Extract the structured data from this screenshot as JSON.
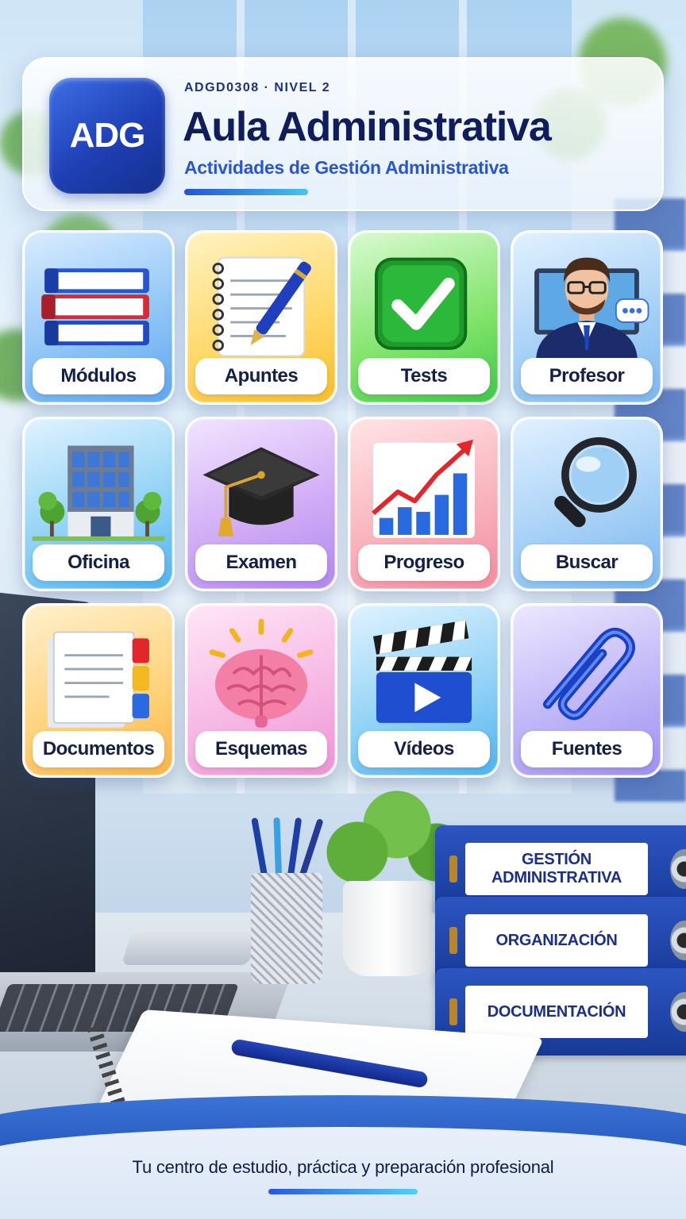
{
  "header": {
    "logo_text": "ADG",
    "overline": "ADGD0308 · NIVEL 2",
    "title": "Aula Administrativa",
    "subtitle": "Actividades de Gestión Administrativa"
  },
  "tiles": [
    {
      "label": "Módulos",
      "icon": "books-icon"
    },
    {
      "label": "Apuntes",
      "icon": "notepad-pen-icon"
    },
    {
      "label": "Tests",
      "icon": "checkmark-icon"
    },
    {
      "label": "Profesor",
      "icon": "teacher-icon"
    },
    {
      "label": "Oficina",
      "icon": "office-building-icon"
    },
    {
      "label": "Examen",
      "icon": "graduation-cap-icon"
    },
    {
      "label": "Progreso",
      "icon": "growth-chart-icon"
    },
    {
      "label": "Buscar",
      "icon": "magnifier-icon"
    },
    {
      "label": "Documentos",
      "icon": "documents-icon"
    },
    {
      "label": "Esquemas",
      "icon": "brain-icon"
    },
    {
      "label": "Vídeos",
      "icon": "clapperboard-icon"
    },
    {
      "label": "Fuentes",
      "icon": "paperclip-icon"
    }
  ],
  "binders": [
    "GESTIÓN ADMINISTRATIVA",
    "ORGANIZACIÓN",
    "DOCUMENTACIÓN"
  ],
  "footer": {
    "tagline": "Tu centro de estudio, práctica y preparación profesional"
  },
  "colors": {
    "brand_blue": "#1e3fb4",
    "title_navy": "#101d5c",
    "accent_blue": "#2a55d0"
  }
}
